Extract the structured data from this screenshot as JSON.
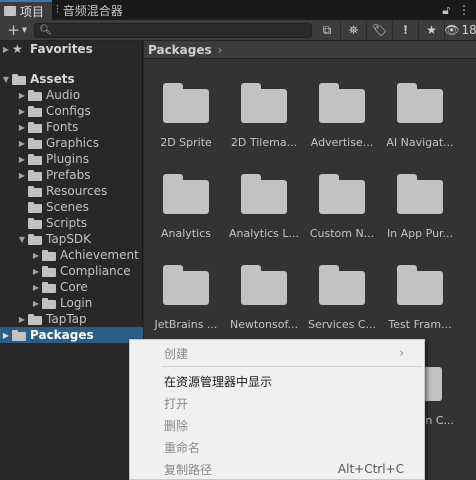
{
  "tabs": [
    {
      "label": "项目",
      "icon": "folder-icon",
      "active": true
    },
    {
      "label": "音频混合器",
      "icon": "mixer-icon",
      "active": false
    }
  ],
  "toolbar": {
    "add": "+",
    "search_value": "",
    "hidden_count": "18"
  },
  "tree": {
    "favorites": "Favorites",
    "assets": "Assets",
    "asset_children": [
      "Audio",
      "Configs",
      "Fonts",
      "Graphics",
      "Plugins",
      "Prefabs",
      "Resources",
      "Scenes",
      "Scripts",
      "TapSDK"
    ],
    "tapsdk_children": [
      "Achievement",
      "Compliance",
      "Core",
      "Login"
    ],
    "taptap": "TapTap",
    "packages": "Packages"
  },
  "breadcrumb": "Packages",
  "grid": [
    "2D Sprite",
    "2D Tilema...",
    "Advertise...",
    "AI Navigat...",
    "Analytics",
    "Analytics L...",
    "Custom N...",
    "In App Pur...",
    "JetBrains ...",
    "Newtonsof...",
    "Services C...",
    "Test Fram..."
  ],
  "grid_partial": "on C...",
  "menu": {
    "create": "创建",
    "show_in_explorer": "在资源管理器中显示",
    "open": "打开",
    "delete": "删除",
    "rename": "重命名",
    "copy_path": "复制路径",
    "copy_path_shortcut": "Alt+Ctrl+C"
  }
}
